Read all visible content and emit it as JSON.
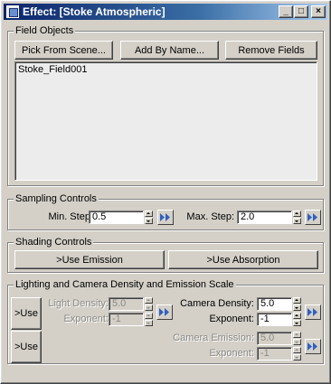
{
  "window": {
    "title": "Effect: [Stoke Atmospheric]",
    "minimize_glyph": "_",
    "maximize_glyph": "□",
    "close_glyph": "×"
  },
  "field_objects": {
    "legend": "Field Objects",
    "pick_button": "Pick From Scene...",
    "add_button": "Add By Name...",
    "remove_button": "Remove Fields",
    "items": [
      "Stoke_Field001"
    ]
  },
  "sampling": {
    "legend": "Sampling Controls",
    "min_step_label": "Min. Step:",
    "min_step_value": "0.5",
    "max_step_label": "Max. Step:",
    "max_step_value": "2.0"
  },
  "shading": {
    "legend": "Shading Controls",
    "use_emission": ">Use Emission",
    "use_absorption": ">Use Absorption"
  },
  "lighting": {
    "legend": "Lighting and Camera Density and Emission Scale",
    "use_button_1": ">Use",
    "use_button_2": ">Use",
    "light_density_label": "Light Density:",
    "light_density_value": "5.0",
    "light_exponent_label": "Exponent:",
    "light_exponent_value": "-1",
    "camera_density_label": "Camera Density:",
    "camera_density_value": "5.0",
    "camera_exponent_label": "Exponent:",
    "camera_exponent_value": "-1",
    "camera_emission_label": "Camera Emission:",
    "camera_emission_value": "5.0",
    "emission_exponent_label": "Exponent:",
    "emission_exponent_value": "-1"
  },
  "colors": {
    "titlebar_start": "#0a246a",
    "titlebar_end": "#a6caf0",
    "panel": "#d4d0c8",
    "fastforward_icon": "#3060c0"
  }
}
